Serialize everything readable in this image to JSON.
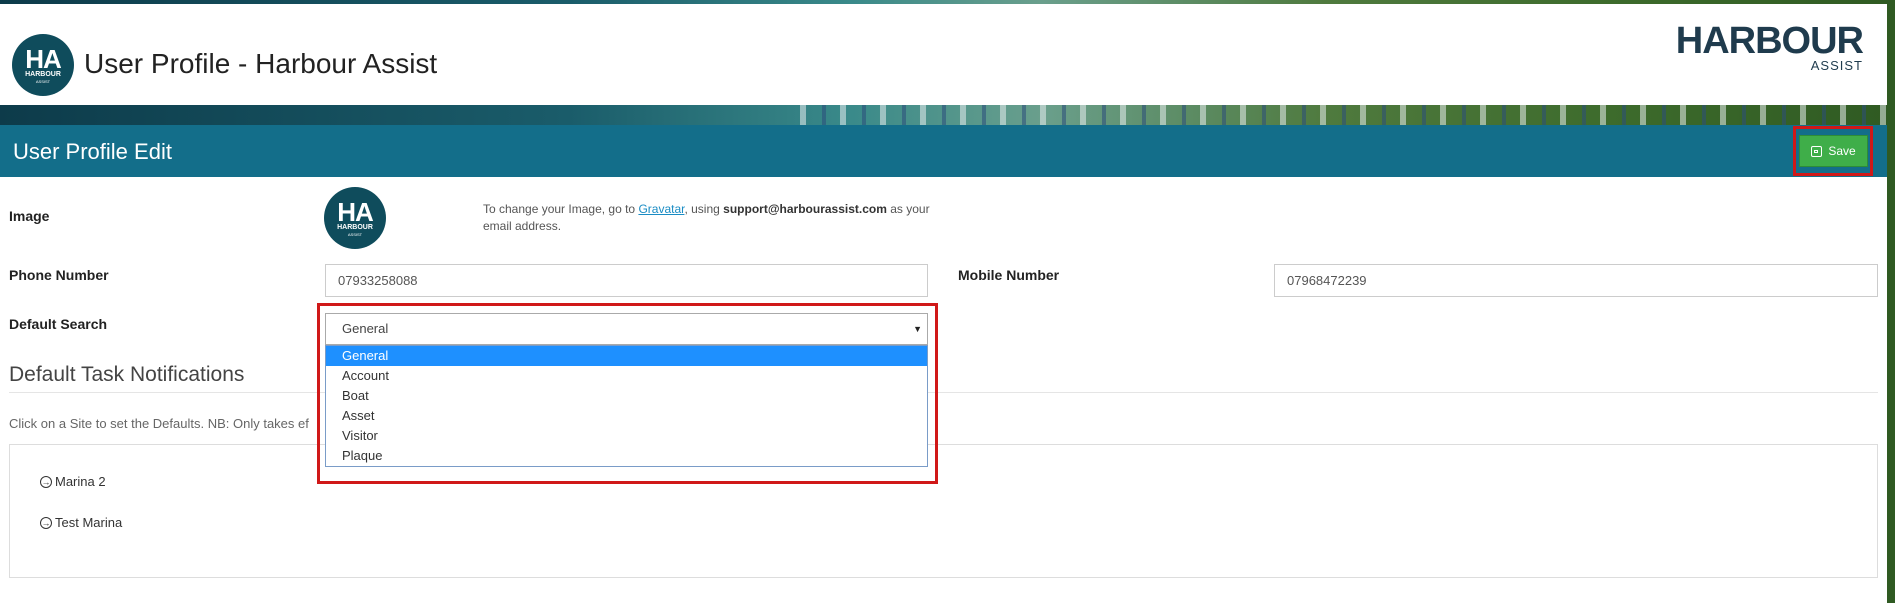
{
  "header": {
    "logo": {
      "big": "HA",
      "mid": "HARBOUR",
      "small": "ASSIST"
    },
    "title": "User Profile - Harbour Assist",
    "brand": {
      "name": "HARBOUR",
      "sub": "ASSIST"
    }
  },
  "bar": {
    "title": "User Profile Edit",
    "save_label": "Save",
    "save_icon": "save-icon"
  },
  "form": {
    "image_label": "Image",
    "help": {
      "pre": "To change your Image, go to ",
      "link": "Gravatar",
      "mid": ", using ",
      "email": "support@harbourassist.com",
      "post": " as your email address."
    },
    "phone_label": "Phone Number",
    "phone_value": "07933258088",
    "mobile_label": "Mobile Number",
    "mobile_value": "07968472239",
    "search_label": "Default Search",
    "search_value": "General",
    "search_options": [
      "General",
      "Account",
      "Boat",
      "Asset",
      "Visitor",
      "Plaque"
    ]
  },
  "notifications": {
    "title": "Default Task Notifications",
    "note": "Click on a Site to set the Defaults. NB: Only takes ef",
    "sites": [
      "Marina 2",
      "Test Marina"
    ]
  },
  "colors": {
    "bar": "#136e8a",
    "save": "#3fae49",
    "highlight": "#d01818",
    "selected_option": "#1e90ff"
  }
}
